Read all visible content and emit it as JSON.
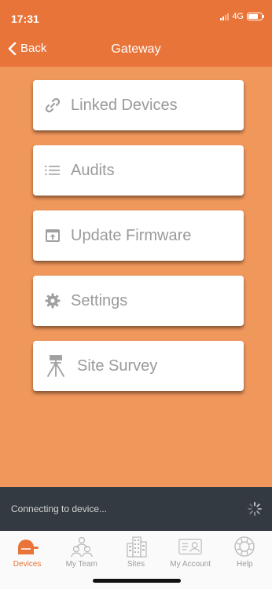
{
  "status_bar": {
    "time": "17:31",
    "network": "4G"
  },
  "nav": {
    "back_label": "Back",
    "title": "Gateway"
  },
  "menu": [
    {
      "label": "Linked Devices",
      "icon": "link-icon"
    },
    {
      "label": "Audits",
      "icon": "list-icon"
    },
    {
      "label": "Update Firmware",
      "icon": "firmware-upload-icon"
    },
    {
      "label": "Settings",
      "icon": "gear-icon"
    },
    {
      "label": "Site Survey",
      "icon": "survey-tripod-icon"
    }
  ],
  "connection": {
    "message": "Connecting to device..."
  },
  "tabs": [
    {
      "label": "Devices",
      "icon": "devices-icon",
      "active": true
    },
    {
      "label": "My Team",
      "icon": "team-icon",
      "active": false
    },
    {
      "label": "Sites",
      "icon": "buildings-icon",
      "active": false
    },
    {
      "label": "My Account",
      "icon": "account-card-icon",
      "active": false
    },
    {
      "label": "Help",
      "icon": "lifebuoy-icon",
      "active": false
    }
  ],
  "colors": {
    "header": "#e9743a",
    "background": "#f0975c",
    "connection_bar": "#333a41",
    "accent": "#e9743a"
  }
}
